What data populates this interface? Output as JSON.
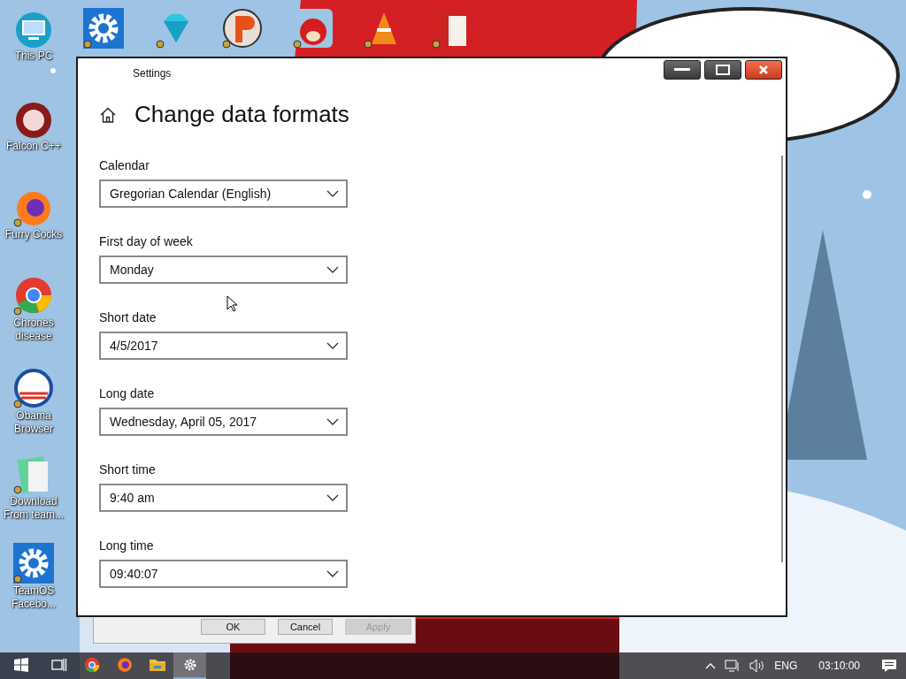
{
  "desktop_icons_left": [
    {
      "label": "This PC",
      "kind": "monitor"
    },
    {
      "label": "Falcon C++",
      "kind": "recycle"
    },
    {
      "label": "Furry Cocks",
      "kind": "fox"
    },
    {
      "label": "Chrones disease",
      "kind": "chrome"
    },
    {
      "label": "Obama Browser",
      "kind": "sunrise"
    },
    {
      "label": "Download From team...",
      "kind": "notepad"
    },
    {
      "label": "TeamOS Facebo...",
      "kind": "gear"
    }
  ],
  "desktop_icons_top": [
    {
      "kind": "gear"
    },
    {
      "kind": "gem"
    },
    {
      "kind": "disc"
    },
    {
      "kind": "bird"
    },
    {
      "kind": "cone"
    },
    {
      "kind": "card"
    }
  ],
  "window": {
    "title": "Settings",
    "heading": "Change data formats",
    "fields": [
      {
        "label": "Calendar",
        "value": "Gregorian Calendar (English)"
      },
      {
        "label": "First day of week",
        "value": "Monday"
      },
      {
        "label": "Short date",
        "value": "4/5/2017"
      },
      {
        "label": "Long date",
        "value": "Wednesday, April 05, 2017"
      },
      {
        "label": "Short time",
        "value": "9:40 am"
      },
      {
        "label": "Long time",
        "value": "09:40:07"
      }
    ]
  },
  "dialog_behind": {
    "buttons": [
      {
        "label": "OK",
        "disabled": false
      },
      {
        "label": "Cancel",
        "disabled": false
      },
      {
        "label": "Apply",
        "disabled": true
      }
    ]
  },
  "taskbar": {
    "items": [
      {
        "kind": "start",
        "selected": false
      },
      {
        "kind": "taskview",
        "selected": false
      },
      {
        "kind": "chrome",
        "selected": false
      },
      {
        "kind": "firefox",
        "selected": false
      },
      {
        "kind": "folder",
        "selected": false
      },
      {
        "kind": "settings",
        "selected": true
      }
    ],
    "language": "ENG",
    "clock": "03:10:00"
  }
}
